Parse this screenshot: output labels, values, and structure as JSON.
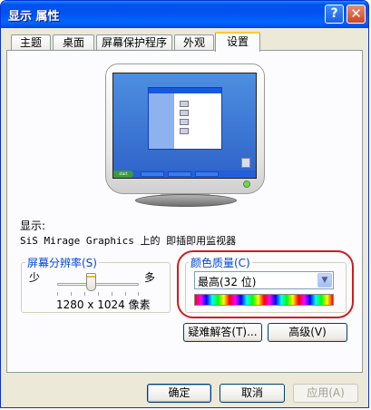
{
  "window": {
    "title": "显示 属性",
    "help_glyph": "?",
    "close_glyph": "✕"
  },
  "tabs": [
    {
      "label": "主题",
      "active": false
    },
    {
      "label": "桌面",
      "active": false
    },
    {
      "label": "屏幕保护程序",
      "active": false
    },
    {
      "label": "外观",
      "active": false
    },
    {
      "label": "设置",
      "active": true
    }
  ],
  "preview": {
    "start_label": "start"
  },
  "display": {
    "label": "显示:",
    "device": "SiS Mirage Graphics 上的 即插即用监视器"
  },
  "resolution": {
    "group_title": "屏幕分辨率(S)",
    "less_label": "少",
    "more_label": "多",
    "value_text": "1280 x 1024 像素",
    "slider_fraction": 0.4
  },
  "color_quality": {
    "group_title": "颜色质量(C)",
    "selected": "最高(32 位)"
  },
  "buttons": {
    "troubleshoot": "疑难解答(T)...",
    "advanced": "高级(V)",
    "ok": "确定",
    "cancel": "取消",
    "apply": "应用(A)"
  },
  "colors": {
    "titlebar": "#0053ee",
    "highlight": "#d01c1c",
    "group_title": "#0046d5"
  }
}
